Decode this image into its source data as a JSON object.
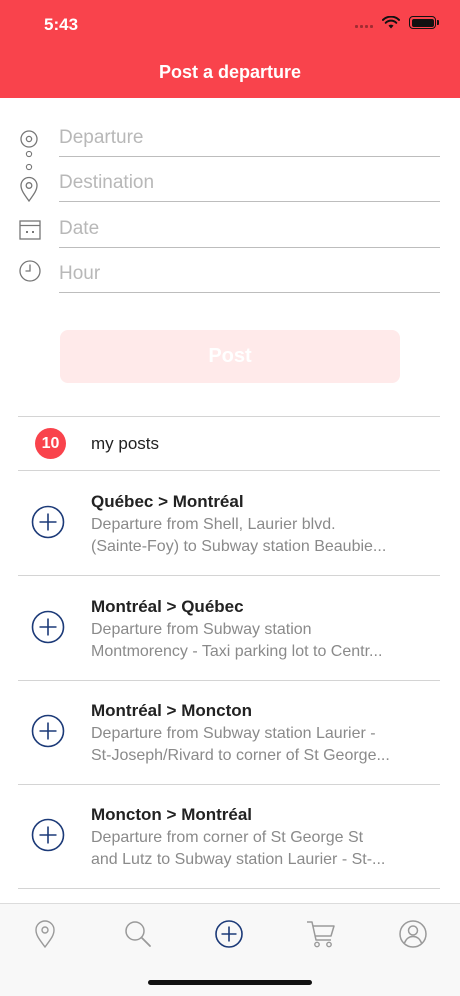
{
  "status_bar": {
    "time": "5:43"
  },
  "header": {
    "title": "Post a departure"
  },
  "form": {
    "departure_placeholder": "Departure",
    "destination_placeholder": "Destination",
    "date_placeholder": "Date",
    "hour_placeholder": "Hour",
    "post_label": "Post"
  },
  "my_posts": {
    "count": "10",
    "label": "my posts"
  },
  "posts": [
    {
      "route": "Québec > Montréal",
      "line1": "Departure from Shell, Laurier blvd.",
      "line2": "(Sainte-Foy) to Subway station Beaubie..."
    },
    {
      "route": "Montréal > Québec",
      "line1": "Departure from Subway station",
      "line2": "Montmorency - Taxi parking lot to Centr..."
    },
    {
      "route": "Montréal > Moncton",
      "line1": "Departure from Subway station Laurier -",
      "line2": "St-Joseph/Rivard to corner of St George..."
    },
    {
      "route": "Moncton > Montréal",
      "line1": "Departure from corner of St George St",
      "line2": "and Lutz to Subway station Laurier - St-..."
    }
  ],
  "tabbar": {
    "items": [
      {
        "icon": "location-pin-icon"
      },
      {
        "icon": "search-icon"
      },
      {
        "icon": "add-circle-icon",
        "active": true
      },
      {
        "icon": "cart-icon"
      },
      {
        "icon": "profile-icon"
      }
    ]
  },
  "colors": {
    "brand": "#f9434c",
    "accent_blue": "#1c3a78",
    "disabled_button": "#ffeaea"
  }
}
